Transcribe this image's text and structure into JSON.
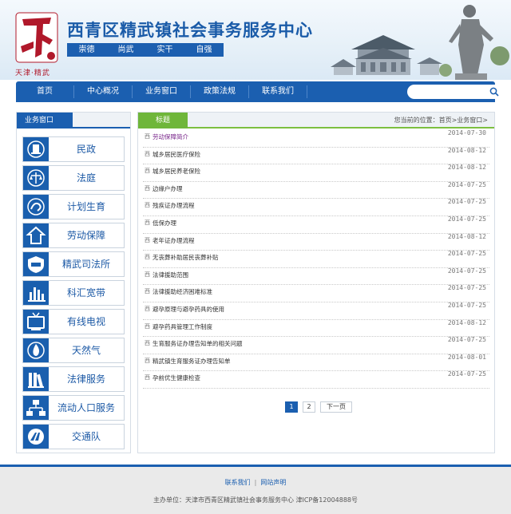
{
  "header": {
    "site_title": "西青区精武镇社会事务服务中心",
    "logo_caption": "天津·精武",
    "motto": [
      "崇德",
      "尚武",
      "实干",
      "自强"
    ]
  },
  "nav": {
    "items": [
      "首页",
      "中心概况",
      "业务窗口",
      "政策法规",
      "联系我们"
    ],
    "search_placeholder": ""
  },
  "sidebar": {
    "title": "业务窗口",
    "items": [
      {
        "label": "民政",
        "icon": "civil-affairs-icon"
      },
      {
        "label": "法庭",
        "icon": "court-icon"
      },
      {
        "label": "计划生育",
        "icon": "family-planning-icon"
      },
      {
        "label": "劳动保障",
        "icon": "labor-security-icon"
      },
      {
        "label": "精武司法所",
        "icon": "judicial-office-icon"
      },
      {
        "label": "科汇宽带",
        "icon": "broadband-icon"
      },
      {
        "label": "有线电视",
        "icon": "tv-icon"
      },
      {
        "label": "天然气",
        "icon": "gas-flame-icon"
      },
      {
        "label": "法律服务",
        "icon": "books-icon"
      },
      {
        "label": "流动人口服务",
        "icon": "org-chart-icon"
      },
      {
        "label": "交通队",
        "icon": "traffic-icon"
      }
    ]
  },
  "main": {
    "tab_label": "标题",
    "breadcrumb": "您当前的位置：首页>业务窗口>",
    "bullet": "西",
    "news": [
      {
        "title": "劳动保障简介",
        "date": "2014-07-30",
        "active": true
      },
      {
        "title": "城乡居民医疗保险",
        "date": "2014-08-12"
      },
      {
        "title": "城乡居民养老保险",
        "date": "2014-08-12"
      },
      {
        "title": "边缘户办理",
        "date": "2014-07-25"
      },
      {
        "title": "残疾证办理流程",
        "date": "2014-07-25"
      },
      {
        "title": "低保办理",
        "date": "2014-07-25"
      },
      {
        "title": "老年证办理流程",
        "date": "2014-08-12"
      },
      {
        "title": "无丧葬补助居民丧葬补贴",
        "date": "2014-07-25"
      },
      {
        "title": "法律援助范围",
        "date": "2014-07-25"
      },
      {
        "title": "法律援助经济困难标准",
        "date": "2014-07-25"
      },
      {
        "title": "避孕原理与避孕药具的使用",
        "date": "2014-07-25"
      },
      {
        "title": "避孕药具管理工作制度",
        "date": "2014-08-12"
      },
      {
        "title": "生育服务证办理告知单的相关问题",
        "date": "2014-07-25"
      },
      {
        "title": "精武镇生育服务证办理告知单",
        "date": "2014-08-01"
      },
      {
        "title": "孕前优生健康检查",
        "date": "2014-07-25"
      }
    ],
    "pager": {
      "pages": [
        "1",
        "2"
      ],
      "current": "1",
      "next_label": "下一页"
    }
  },
  "footer": {
    "links": [
      "联系我们",
      "网站声明"
    ],
    "separator": "|",
    "copyright": "主办单位：天津市西青区精武镇社会事务服务中心 津ICP备12004888号"
  },
  "colors": {
    "primary_blue": "#1b5fb0",
    "accent_green": "#6fb63a",
    "logo_red": "#b0182a",
    "active_link": "#7b2a8d"
  }
}
